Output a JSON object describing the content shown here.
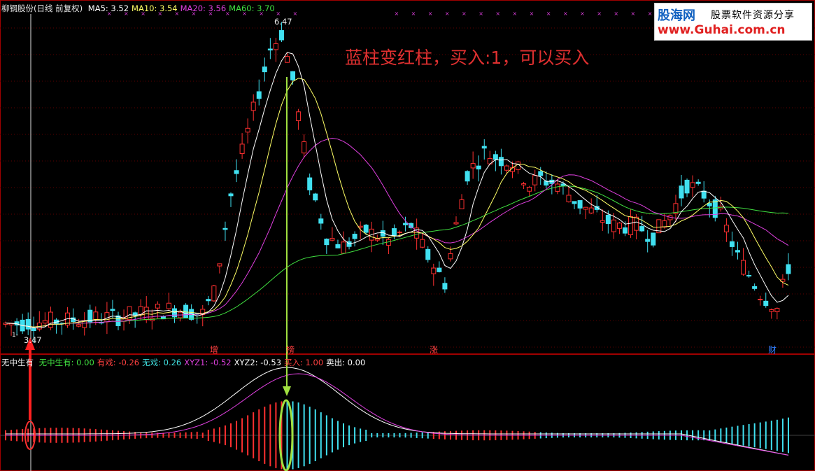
{
  "stock": {
    "name": "柳钢股份(日线 前复权)"
  },
  "ma_legend": [
    {
      "label": "MA5: 3.52",
      "color": "#ffffff"
    },
    {
      "label": "MA10: 3.54",
      "color": "#ffff66"
    },
    {
      "label": "MA20: 3.56",
      "color": "#e040e0"
    },
    {
      "label": "MA60: 3.70",
      "color": "#40e040"
    }
  ],
  "price_labels": {
    "high": "6.47",
    "low": "3.47",
    "low_prefix": "1-"
  },
  "annotation": "蓝柱变红柱，买入:1，可以买入",
  "logo": {
    "brand": "股海网",
    "tagline": "股票软件资源分享",
    "url": "www.Guhai.com.cn"
  },
  "event_markers": [
    {
      "label": "增",
      "color": "#ff4040"
    },
    {
      "label": "榜",
      "color": "#ff4040"
    },
    {
      "label": "涨",
      "color": "#ff4040"
    },
    {
      "label": "财",
      "color": "#3080ff"
    }
  ],
  "indicator": {
    "title": "无中生有",
    "values": [
      {
        "label": "无中生有: 0.00",
        "color": "#40e040"
      },
      {
        "label": "有戏: -0.26",
        "color": "#ff4040"
      },
      {
        "label": "无戏: 0.26",
        "color": "#40e0e0"
      },
      {
        "label": "XYZ1: -0.52",
        "color": "#e040e0"
      },
      {
        "label": "XYZ2: -0.53",
        "color": "#ffffff"
      },
      {
        "label": "买入: 1.00",
        "color": "#ff4040"
      },
      {
        "label": "卖出: 0.00",
        "color": "#ffffff"
      }
    ]
  },
  "colors": {
    "up": "#ff3030",
    "down": "#40e0f0",
    "ma5": "#ffffff",
    "ma10": "#ffff66",
    "ma20": "#e040e0",
    "ma60": "#40e040",
    "arrow_red": "#ff2020",
    "arrow_green": "#a0e040",
    "ellipse_green": "#a0e040",
    "ellipse_red": "#ff3030"
  },
  "chart_data": {
    "type": "candlestick",
    "title": "柳钢股份(日线 前复权)",
    "ma_last": {
      "MA5": 3.52,
      "MA10": 3.54,
      "MA20": 3.56,
      "MA60": 3.7
    },
    "price_range_visible": [
      3.47,
      6.47
    ],
    "annotated_high": 6.47,
    "annotated_low": 3.47,
    "signal_text": "蓝柱变红柱，买入:1，可以买入",
    "indicator_name": "无中生有",
    "indicator_last": {
      "无中生有": 0.0,
      "有戏": -0.26,
      "无戏": 0.26,
      "XYZ1": -0.52,
      "XYZ2": -0.53,
      "买入": 1.0,
      "卖出": 0.0
    }
  }
}
